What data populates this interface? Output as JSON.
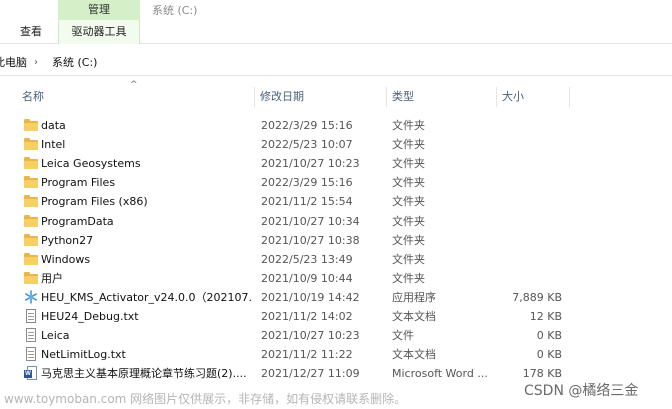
{
  "ribbon": {
    "manage_tab": "管理",
    "window_title": "系统 (C:)",
    "tab_view": "查看",
    "tab_drive_tools": "驱动器工具"
  },
  "address": {
    "crumb_pc": "此电脑",
    "separator": "›",
    "crumb_drive": "系统 (C:)"
  },
  "columns": {
    "name": "名称",
    "modified": "修改日期",
    "type": "类型",
    "size": "大小",
    "sort_indicator": "^"
  },
  "files": [
    {
      "icon": "folder-icon",
      "name": "data",
      "date": "2022/3/29 15:16",
      "type": "文件夹",
      "size": ""
    },
    {
      "icon": "folder-icon",
      "name": "Intel",
      "date": "2022/5/23 10:07",
      "type": "文件夹",
      "size": ""
    },
    {
      "icon": "folder-icon",
      "name": "Leica Geosystems",
      "date": "2021/10/27 10:23",
      "type": "文件夹",
      "size": ""
    },
    {
      "icon": "folder-icon",
      "name": "Program Files",
      "date": "2022/3/29 15:16",
      "type": "文件夹",
      "size": ""
    },
    {
      "icon": "folder-icon",
      "name": "Program Files (x86)",
      "date": "2021/11/2 15:54",
      "type": "文件夹",
      "size": ""
    },
    {
      "icon": "folder-icon",
      "name": "ProgramData",
      "date": "2021/10/27 10:34",
      "type": "文件夹",
      "size": ""
    },
    {
      "icon": "folder-icon",
      "name": "Python27",
      "date": "2021/10/27 10:38",
      "type": "文件夹",
      "size": ""
    },
    {
      "icon": "folder-icon",
      "name": "Windows",
      "date": "2022/5/23 13:49",
      "type": "文件夹",
      "size": ""
    },
    {
      "icon": "folder-icon",
      "name": "用户",
      "date": "2021/10/9 10:44",
      "type": "文件夹",
      "size": ""
    },
    {
      "icon": "snowflake-app-icon",
      "name": "HEU_KMS_Activator_v24.0.0（202107...",
      "date": "2021/10/19 14:42",
      "type": "应用程序",
      "size": "7,889 KB"
    },
    {
      "icon": "text-file-icon",
      "name": "HEU24_Debug.txt",
      "date": "2021/11/2 14:02",
      "type": "文本文档",
      "size": "12 KB"
    },
    {
      "icon": "text-file-icon",
      "name": "Leica",
      "date": "2021/10/27 10:23",
      "type": "文件",
      "size": "0 KB"
    },
    {
      "icon": "text-file-icon",
      "name": "NetLimitLog.txt",
      "date": "2021/11/2 11:22",
      "type": "文本文档",
      "size": "0 KB"
    },
    {
      "icon": "word-doc-icon",
      "name": "马克思主义基本原理概论章节练习题(2)....",
      "date": "2021/12/27 11:09",
      "type": "Microsoft Word ...",
      "size": "178 KB"
    }
  ],
  "watermarks": {
    "left": "www.toymoban.com 网络图片仅供展示，非存储，如有侵权请联系删除。",
    "right": "CSDN @橘络三金"
  }
}
